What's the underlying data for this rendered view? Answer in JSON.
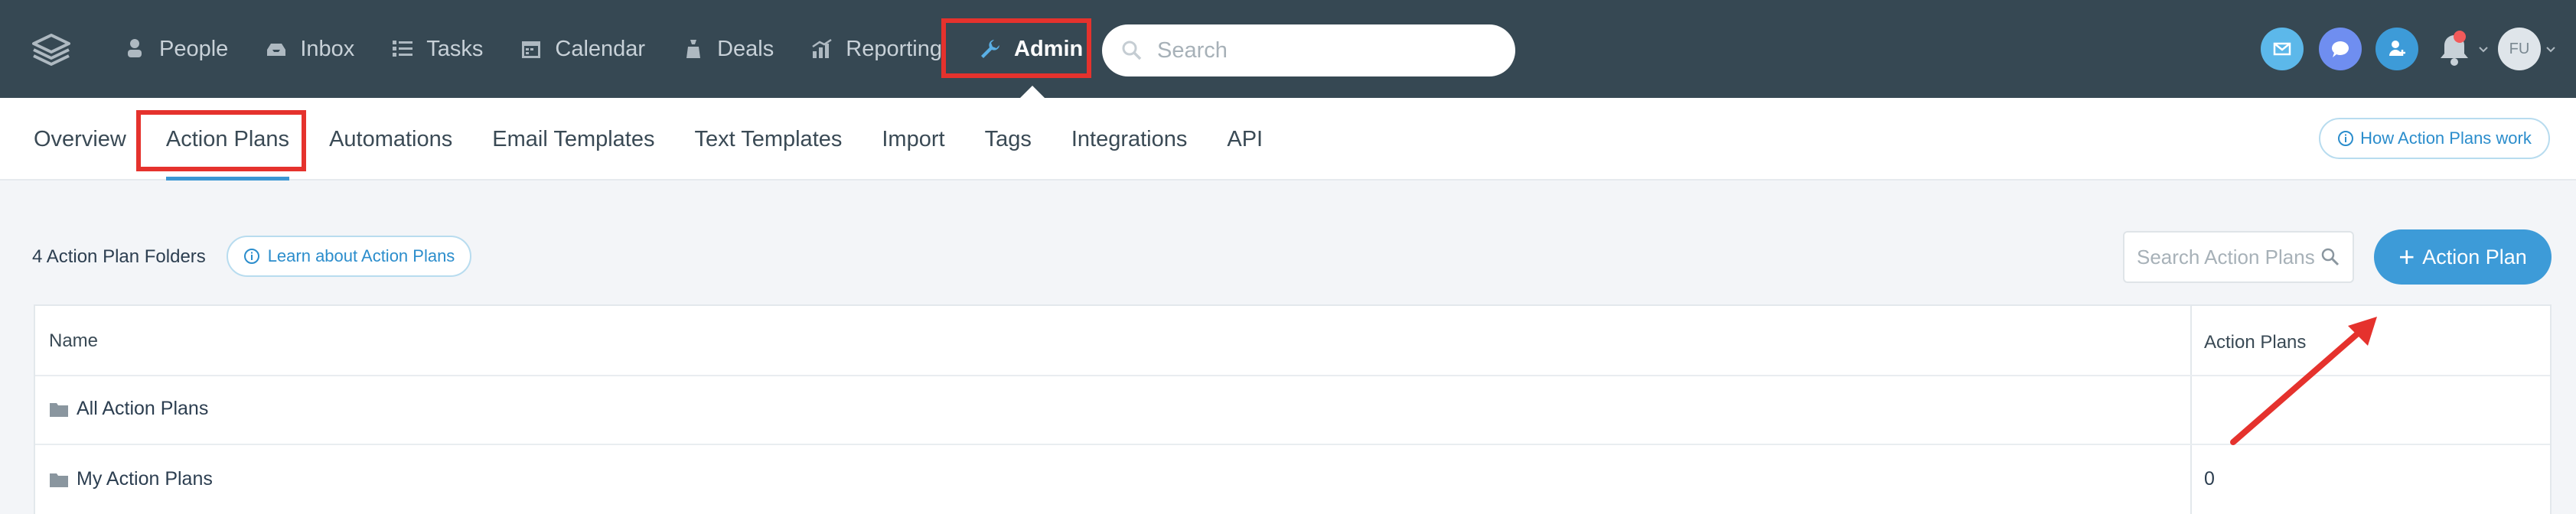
{
  "topbar": {
    "logo_icon": "stacked-layers-icon",
    "nav": [
      {
        "label": "People",
        "icon": "people-icon"
      },
      {
        "label": "Inbox",
        "icon": "inbox-icon"
      },
      {
        "label": "Tasks",
        "icon": "tasks-list-icon"
      },
      {
        "label": "Calendar",
        "icon": "calendar-icon"
      },
      {
        "label": "Deals",
        "icon": "deals-bag-icon"
      },
      {
        "label": "Reporting",
        "icon": "chart-icon"
      },
      {
        "label": "Admin",
        "icon": "wrench-icon",
        "active": true
      }
    ],
    "search": {
      "placeholder": "Search"
    },
    "actions": [
      {
        "icon": "email-icon",
        "color": "#5cb8ea"
      },
      {
        "icon": "chat-icon",
        "color": "#6f8ef0"
      },
      {
        "icon": "add-contact-icon",
        "color": "#3d9bd8"
      }
    ],
    "notifications_icon": "bell-icon",
    "avatar_initials": "FU"
  },
  "subnav": {
    "items": [
      {
        "label": "Overview"
      },
      {
        "label": "Action Plans",
        "active": true
      },
      {
        "label": "Automations"
      },
      {
        "label": "Email Templates"
      },
      {
        "label": "Text Templates"
      },
      {
        "label": "Import"
      },
      {
        "label": "Tags"
      },
      {
        "label": "Integrations"
      },
      {
        "label": "API"
      }
    ],
    "help_link": "How Action Plans work"
  },
  "toolbar": {
    "folder_count": "4 Action Plan Folders",
    "learn_link": "Learn about Action Plans",
    "search_placeholder": "Search Action Plans",
    "add_button_label": "Action Plan"
  },
  "table": {
    "headers": {
      "name": "Name",
      "count": "Action Plans"
    },
    "rows": [
      {
        "name": "All Action Plans",
        "count": ""
      },
      {
        "name": "My Action Plans",
        "count": "0"
      }
    ]
  },
  "colors": {
    "topbar_bg": "#364853",
    "accent": "#3d9bd8",
    "highlight_annotation": "#e5322d"
  }
}
